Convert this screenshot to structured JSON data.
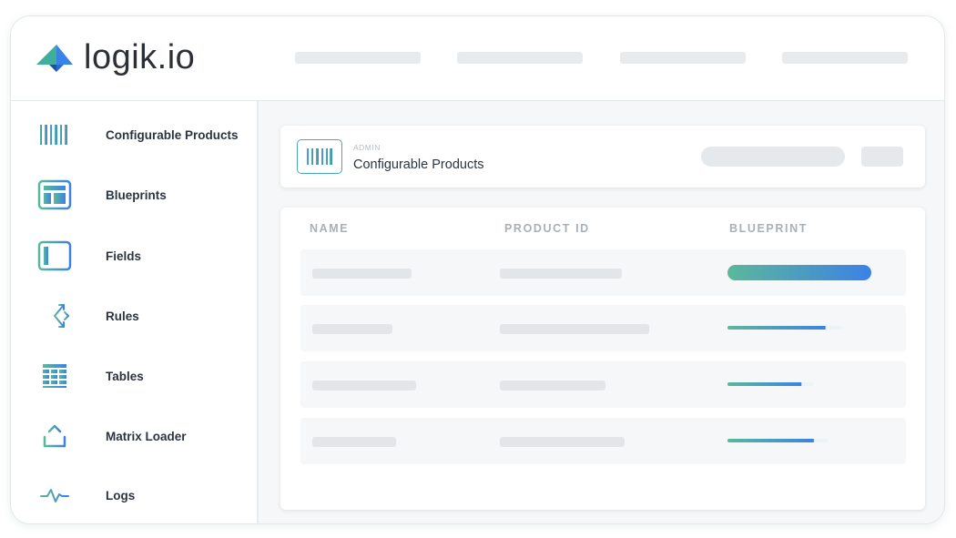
{
  "app": {
    "logo_text": "logik.io",
    "logo_colors": {
      "left": "#3fae9a",
      "right": "#3b82e6",
      "dark": "#1f4fa8"
    }
  },
  "sidebar": {
    "items": [
      {
        "label": "Configurable Products",
        "icon": "barcode-icon"
      },
      {
        "label": "Blueprints",
        "icon": "blueprint-icon"
      },
      {
        "label": "Fields",
        "icon": "fields-icon"
      },
      {
        "label": "Rules",
        "icon": "rules-icon"
      },
      {
        "label": "Tables",
        "icon": "table-icon"
      },
      {
        "label": "Matrix Loader",
        "icon": "upload-icon"
      },
      {
        "label": "Logs",
        "icon": "pulse-icon"
      }
    ]
  },
  "header": {
    "section": "ADMIN",
    "title": "Configurable Products",
    "icon": "barcode-icon"
  },
  "table": {
    "columns": [
      "NAME",
      "PRODUCT ID",
      "BLUEPRINT"
    ],
    "rows": [
      {
        "blueprint_fill": 1.0
      },
      {
        "blueprint_fill": 0.8
      },
      {
        "blueprint_fill": 0.6
      },
      {
        "blueprint_fill": 0.7
      }
    ]
  },
  "colors": {
    "accent_teal": "#5bb89a",
    "accent_blue": "#3b82e6",
    "placeholder": "#e6e9ec"
  }
}
